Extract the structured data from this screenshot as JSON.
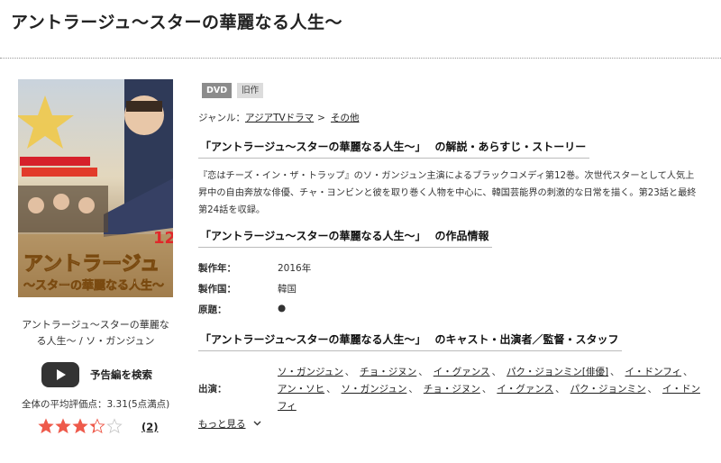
{
  "page": {
    "title": "アントラージュ〜スターの華麗なる人生〜"
  },
  "item": {
    "caption": "アントラージュ〜スターの華麗なる人生〜 / ソ・ガンジュン",
    "cover_lettering": {
      "title": "アントラージュ",
      "subtitle": "〜スターの華麗なる人生〜",
      "volume": "12"
    },
    "trailer_label": "予告編を検索",
    "rating_text": "全体の平均評価点：3.31(5点満点)",
    "rating_value": 3.31,
    "rating_max": 5,
    "review_count": "(2)"
  },
  "badges": {
    "format": "DVD",
    "status": "旧作"
  },
  "genre": {
    "label": "ジャンル：",
    "items": [
      "アジアTVドラマ",
      "その他"
    ],
    "separator": ">"
  },
  "sections": {
    "synopsis_heading": "「アントラージュ〜スターの華麗なる人生〜」",
    "synopsis_heading_suffix": "の解説・あらすじ・ストーリー",
    "synopsis_text": "『恋はチーズ・イン・ザ・トラップ』のソ・ガンジュン主演によるブラックコメディ第12巻。次世代スターとして人気上昇中の自由奔放な俳優、チャ・ヨンビンと彼を取り巻く人物を中心に、韓国芸能界の刺激的な日常を描く。第23話と最終第24話を収録。",
    "info_heading": "「アントラージュ〜スターの華麗なる人生〜」",
    "info_heading_suffix": "の作品情報",
    "info": [
      {
        "key": "製作年：",
        "value": "2016年"
      },
      {
        "key": "製作国：",
        "value": "韓国"
      },
      {
        "key": "原題：",
        "value": "●"
      }
    ],
    "cast_heading": "「アントラージュ〜スターの華麗なる人生〜」",
    "cast_heading_suffix": "のキャスト・出演者／監督・スタッフ",
    "cast_label": "出演：",
    "cast": [
      "ソ・ガンジュン",
      "チョ・ジヌン",
      "イ・グァンス",
      "パク・ジョンミン[俳優]",
      "イ・ドンフィ",
      "アン・ソヒ",
      "ソ・ガンジュン",
      "チョ・ジヌン",
      "イ・グァンス",
      "パク・ジョンミン",
      "イ・ドンフィ"
    ],
    "more_label": "もっと見る"
  },
  "colors": {
    "star_fill": "#ee5a4b",
    "badge_dvd": "#8c8c8c",
    "badge_old": "#dcdcdc"
  },
  "icons": {
    "trailer": "play-icon",
    "more": "chevron-down-icon",
    "star": "star-icon"
  }
}
